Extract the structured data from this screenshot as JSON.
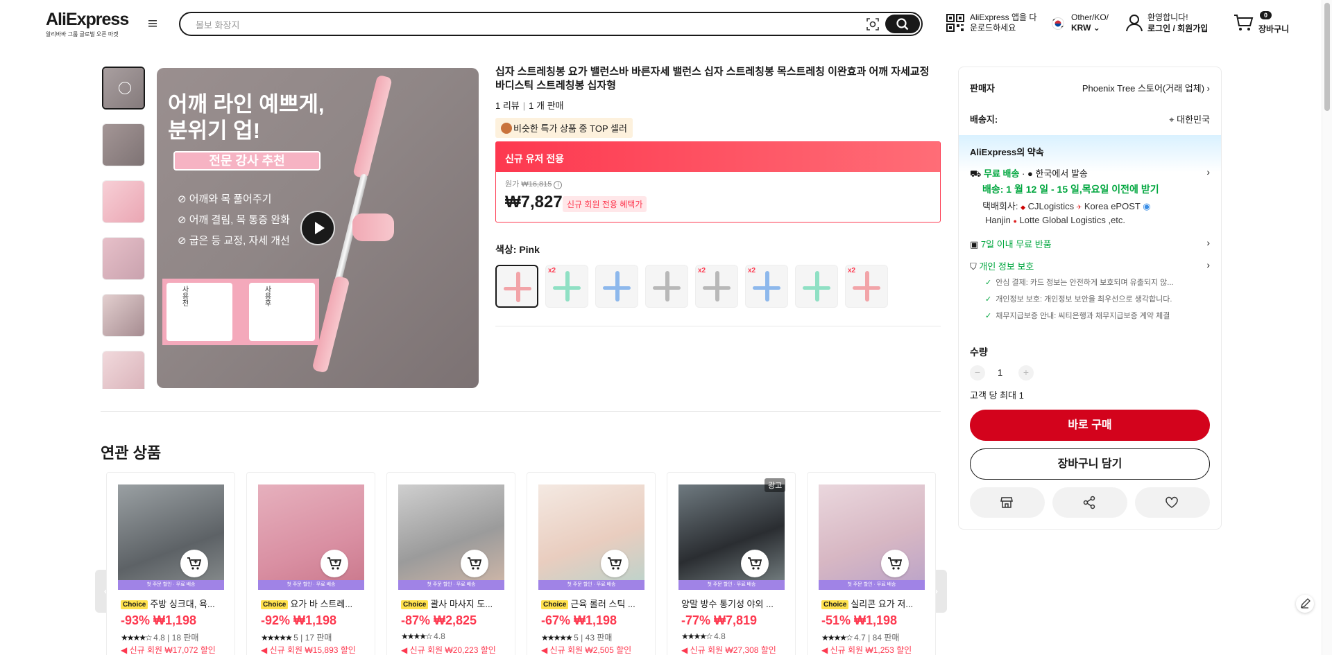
{
  "header": {
    "brand": "AliExpress",
    "brand_sub": "알리바바 그룹 글로벌 오픈 마켓",
    "search_placeholder": "볼보 화장지",
    "app_line1": "AliExpress 앱을 다",
    "app_line2": "운로드하세요",
    "lang_line1": "Other/KO/",
    "lang_line2": "KRW",
    "user_line1": "환영합니다!",
    "user_line2": "로그인 / 회원가입",
    "cart_count": "0",
    "cart_label": "장바구니"
  },
  "gallery": {
    "headline": "어깨 라인 예쁘게,\n분위기 업!",
    "tag": "전문 강사 추천",
    "features": [
      "어깨와 목 풀어주기",
      "어깨 결림, 목 통증 완화",
      "굽은 등 교정, 자세 개선"
    ],
    "before": "사용전",
    "after": "사용후"
  },
  "product": {
    "title": "십자 스트레칭봉 요가 밸런스바 바른자세 밸런스 십자 스트레칭봉 목스트레칭 이완효과 어깨 자세교정 바디스틱 스트레칭봉 십자형",
    "reviews": "1 리뷰",
    "sold": "1 개 판매",
    "top_seller": "비슷한 특가 상품 중 TOP 셀러",
    "promo_header": "신규 유저 전용",
    "orig_label": "원가",
    "orig_price": "₩16,815",
    "price": "₩7,827",
    "new_badge": "신규 회원 전용 혜택가",
    "color_label": "색상:",
    "color_value": "Pink",
    "swatches": [
      {
        "color": "#f2a4a8",
        "x2": "",
        "selected": true
      },
      {
        "color": "#8fe0c4",
        "x2": "x2"
      },
      {
        "color": "#8db8ec",
        "x2": ""
      },
      {
        "color": "#b8b8b8",
        "x2": ""
      },
      {
        "color": "#b8b8b8",
        "x2": "x2"
      },
      {
        "color": "#8db8ec",
        "x2": "x2"
      },
      {
        "color": "#8fe0c4",
        "x2": ""
      },
      {
        "color": "#f2a4a8",
        "x2": "x2"
      }
    ]
  },
  "panel": {
    "seller_label": "판매자",
    "seller_value": "Phoenix Tree 스토어(거래 업체)",
    "ship_label": "배송지:",
    "ship_value": "대한민국",
    "promise_title": "AliExpress의 약속",
    "free_ship": "무료 배송",
    "ship_from": "한국에서 발송",
    "delivery": "배송: 1 월 12 일 - 15 일,목요일 이전에 받기",
    "carrier_label": "택배회사:",
    "carrier1": "CJLogistics",
    "carrier2": "Korea ePOST",
    "carrier3": "Hanjin",
    "carrier4": "Lotte Global Logistics ,etc.",
    "free_return": "7일 이내 무료 반품",
    "privacy": "개인 정보 보호",
    "privacy_items": [
      "안심 결제: 카드 정보는 안전하게 보호되며 유출되지 않...",
      "개인정보 보호: 개인정보 보안을 최우선으로 생각합니다.",
      "채무지급보증 안내: 씨티은행과 채무지급보증 계약 체결"
    ],
    "qty_label": "수량",
    "qty_value": "1",
    "qty_limit": "고객 당 최대 1",
    "buy_now": "바로 구매",
    "add_cart": "장바구니 담기"
  },
  "related": {
    "title": "연관 상품",
    "band": "첫 주문 할인 · 무료 배송",
    "items": [
      {
        "choice": "Choice",
        "name": "주방 싱크대, 욕...",
        "price": "-93% ₩1,198",
        "stars": "★★★★☆",
        "rating": "4.8",
        "sold": "18 판매",
        "newprice": "신규 회원 ₩17,072 할인",
        "img": "linear-gradient(160deg,#9aa0a3,#5d6266 60%,#8a8f90)",
        "ad": ""
      },
      {
        "choice": "Choice",
        "name": "요가 바 스트레...",
        "price": "-92% ₩1,198",
        "stars": "★★★★★",
        "rating": "5",
        "sold": "17 판매",
        "newprice": "신규 회원 ₩15,893 할인",
        "img": "linear-gradient(160deg,#e6b0bd,#d98fa2 60%,#c9778b)",
        "ad": ""
      },
      {
        "choice": "Choice",
        "name": "괄사 마사지 도...",
        "price": "-87% ₩2,825",
        "stars": "★★★★☆",
        "rating": "4.8",
        "sold": "",
        "newprice": "신규 회원 ₩20,223 할인",
        "img": "linear-gradient(160deg,#cfcfcf,#9b9b9b 55%,#d3b9a9)",
        "ad": ""
      },
      {
        "choice": "Choice",
        "name": "근육 롤러 스틱 ...",
        "price": "-67% ₩1,198",
        "stars": "★★★★★",
        "rating": "5",
        "sold": "43 판매",
        "newprice": "신규 회원 ₩2,505 할인",
        "img": "linear-gradient(160deg,#f4e9e2,#e9cdbf 55%,#b8d3cc)",
        "ad": ""
      },
      {
        "choice": "",
        "name": "양말 방수 통기성 야외 ...",
        "price": "-77% ₩7,819",
        "stars": "★★★★☆",
        "rating": "4.8",
        "sold": "",
        "newprice": "신규 회원 ₩27,308 할인",
        "img": "linear-gradient(160deg,#6f7a80,#2a2d31 55%,#7c8789)",
        "ad": "광고"
      },
      {
        "choice": "Choice",
        "name": "실리콘 요가 저...",
        "price": "-51% ₩1,198",
        "stars": "★★★★☆",
        "rating": "4.7",
        "sold": "84 판매",
        "newprice": "신규 회원 ₩1,253 할인",
        "img": "linear-gradient(160deg,#ead7dd,#d7b7c3 55%,#b9a2c9)",
        "ad": ""
      }
    ]
  }
}
